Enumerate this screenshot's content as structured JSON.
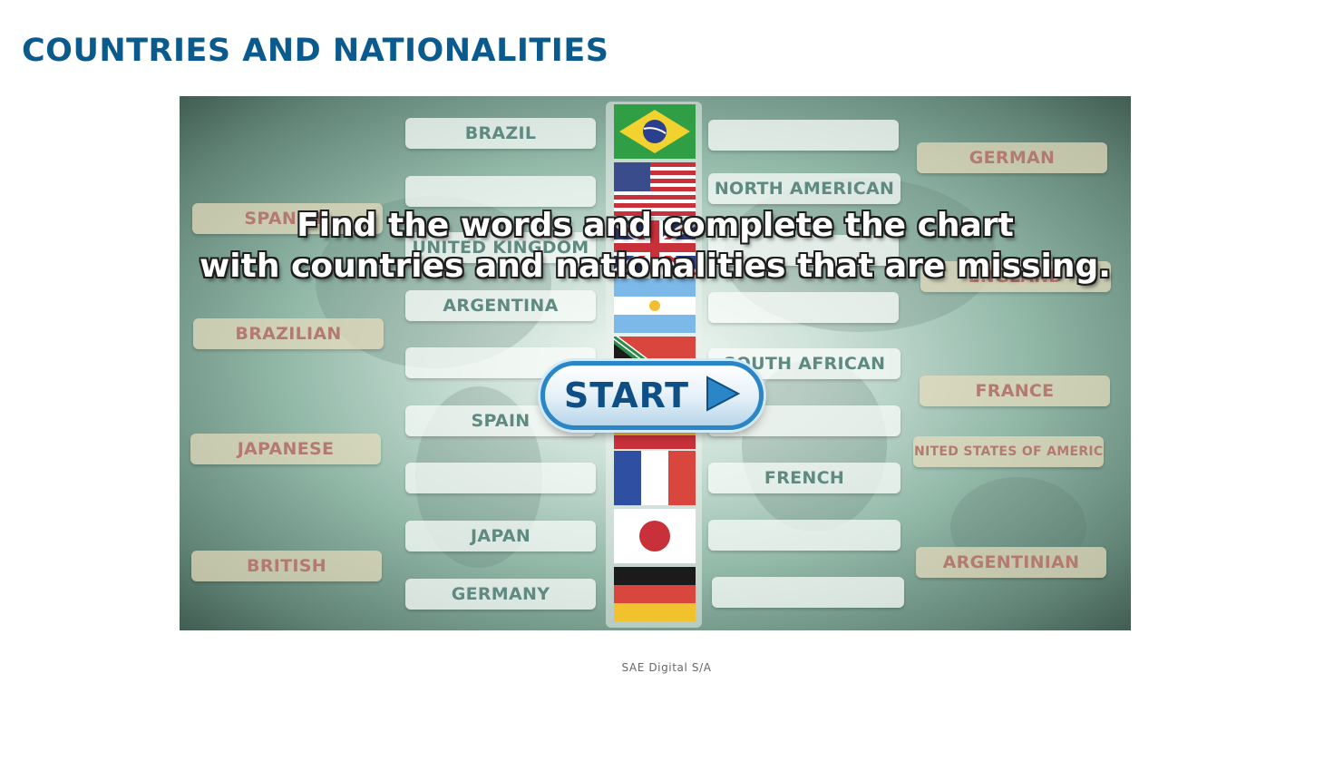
{
  "page": {
    "title": "COUNTRIES AND NATIONALITIES",
    "footer": "SAE Digital S/A"
  },
  "game": {
    "instruction_line1": "Find the words and complete the chart",
    "instruction_line2": "with countries and nationalities that are missing.",
    "start_label": "START",
    "countries_column": [
      "BRAZIL",
      "",
      "UNITED KINGDOM",
      "ARGENTINA",
      "",
      "SPAIN",
      "",
      "JAPAN",
      "GERMANY"
    ],
    "nationalities_column": [
      "",
      "NORTH AMERICAN",
      "",
      "",
      "SOUTH AFRICAN",
      "",
      "FRENCH",
      "",
      ""
    ],
    "left_word_bank": [
      "SPANISH",
      "BRAZILIAN",
      "JAPANESE",
      "BRITISH"
    ],
    "right_word_bank": [
      "GERMAN",
      "ENGLAND",
      "FRANCE",
      "UNITED STATES OF AMERICA",
      "ARGENTINIAN"
    ],
    "flags": [
      "brazil-flag",
      "usa-flag",
      "uk-flag",
      "argentina-flag",
      "south-africa-flag",
      "spain-flag",
      "france-flag",
      "japan-flag",
      "germany-flag"
    ],
    "colors": {
      "title": "#0b5a8e",
      "start_button_border": "#2a86c7",
      "start_label": "#0e4f86"
    }
  }
}
